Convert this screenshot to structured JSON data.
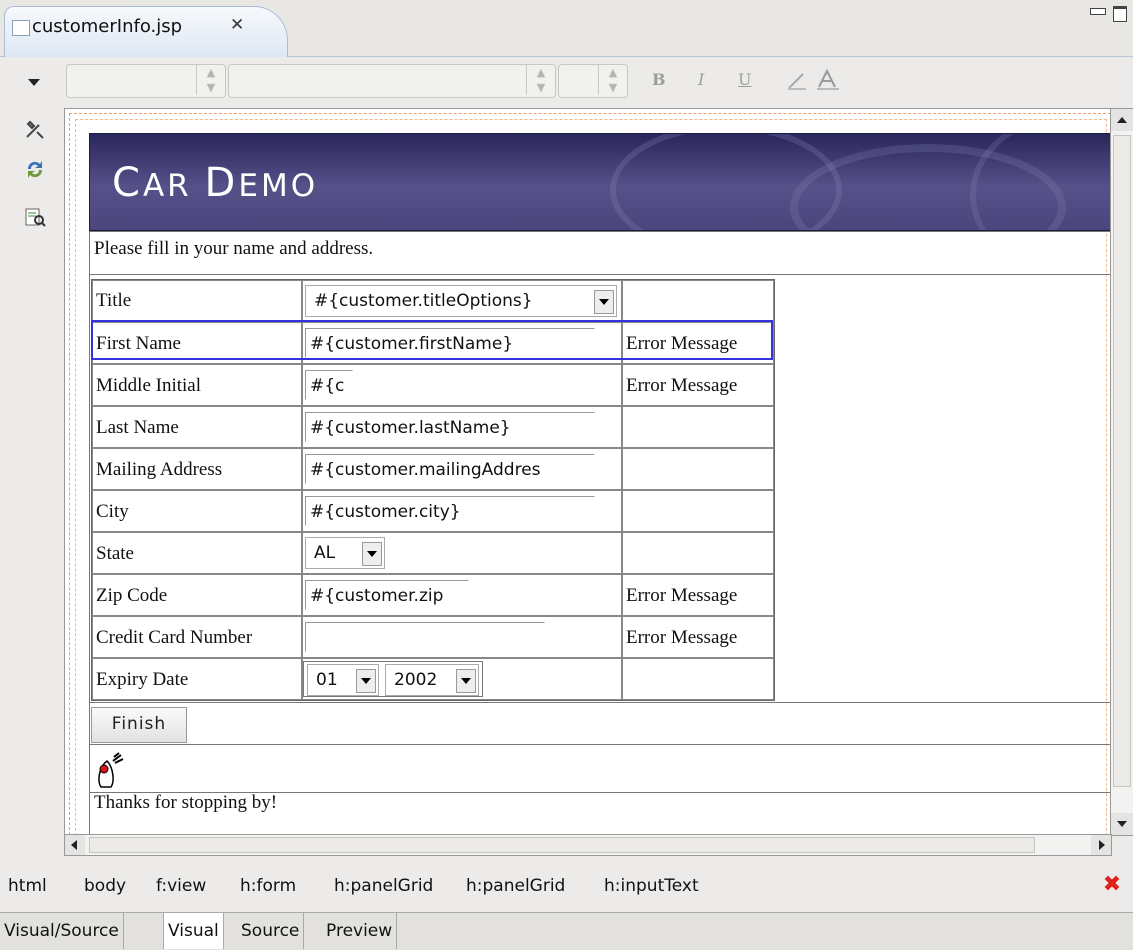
{
  "editor_tab": {
    "title": "customerInfo.jsp",
    "close_glyph": "✕"
  },
  "toolbar": {
    "bold_label": "B",
    "italic_label": "I",
    "underline_label": "U"
  },
  "page": {
    "banner_title_first": "C",
    "banner_title_rest1": "AR ",
    "banner_title_second": "D",
    "banner_title_rest2": "EMO",
    "intro_text": "Please fill in your name and address.",
    "thanks_text": "Thanks for stopping by!",
    "finish_label": "Finish"
  },
  "form": {
    "rows": [
      {
        "label": "Title",
        "value": "#{customer.titleOptions}",
        "error": ""
      },
      {
        "label": "First Name",
        "value": "#{customer.firstName}",
        "error": "Error Message"
      },
      {
        "label": "Middle Initial",
        "value": "#{c",
        "error": "Error Message"
      },
      {
        "label": "Last Name",
        "value": "#{customer.lastName}",
        "error": ""
      },
      {
        "label": "Mailing Address",
        "value": "#{customer.mailingAddres",
        "error": ""
      },
      {
        "label": "City",
        "value": "#{customer.city}",
        "error": ""
      },
      {
        "label": "State",
        "value": "AL",
        "error": ""
      },
      {
        "label": "Zip Code",
        "value": "#{customer.zip",
        "error": "Error Message"
      },
      {
        "label": "Credit Card Number",
        "value": "",
        "error": "Error Message"
      },
      {
        "label": "Expiry Date",
        "value": "01",
        "value2": "2002",
        "error": ""
      }
    ]
  },
  "breadcrumb": [
    "html",
    "body",
    "f:view",
    "h:form",
    "h:panelGrid",
    "h:panelGrid",
    "h:inputText"
  ],
  "bottom_tabs": [
    "Visual/Source",
    "Visual",
    "Source",
    "Preview"
  ],
  "active_bottom_tab": "Visual",
  "colors": {
    "banner": "#4a467d",
    "selection": "#3333dd",
    "close_red": "#e0201a"
  },
  "icons": [
    "file-jsp-icon",
    "close-icon",
    "minimize-icon",
    "maximize-icon",
    "view-menu-icon",
    "tools-icon",
    "refresh-icon",
    "preview-icon",
    "duke-icon",
    "breadcrumb-close-icon"
  ]
}
